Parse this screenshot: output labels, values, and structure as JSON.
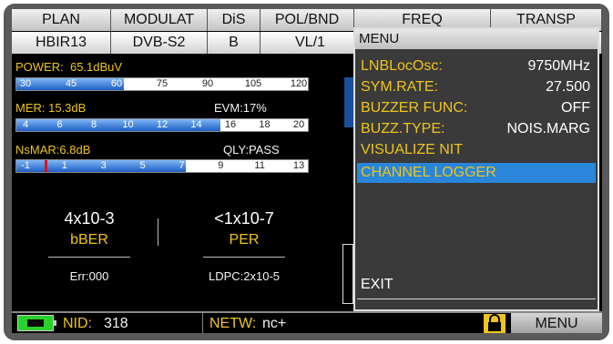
{
  "tabs": [
    "PLAN",
    "MODULAT",
    "DiS",
    "POL/BND",
    "FREQ",
    "TRANSP"
  ],
  "info": [
    "HBIR13",
    "DVB-S2",
    "B",
    "VL/1"
  ],
  "power": {
    "label": "POWER:",
    "value": "65.1dBuV",
    "ticks": [
      "30",
      "45",
      "60",
      "75",
      "90",
      "105",
      "120"
    ],
    "level_fraction": 0.37
  },
  "mer": {
    "label": "MER: 15.3dB",
    "evm": "EVM:17%",
    "ticks": [
      "4",
      "6",
      "8",
      "10",
      "12",
      "14",
      "16",
      "18",
      "20"
    ],
    "level_fraction": 0.7
  },
  "nsmar": {
    "label": "NsMAR:6.8dB",
    "qly": "QLY:PASS",
    "ticks": [
      "-1",
      "1",
      "3",
      "5",
      "7",
      "9",
      "11",
      "13"
    ],
    "level_fraction": 0.58
  },
  "ber": {
    "value": "4x10-3",
    "label": "bBER",
    "err": "Err:000"
  },
  "per": {
    "value": "<1x10-7",
    "label": "PER",
    "ldpc": "LDPC:2x10-5"
  },
  "status": {
    "nid_label": "NID:",
    "nid_value": "318",
    "netw_label": "NETW:",
    "netw_value": "nc+",
    "menu_label": "MENU"
  },
  "menu": {
    "title": "MENU",
    "items": [
      {
        "label": "LNBLocOsc:",
        "value": "9750MHz"
      },
      {
        "label": "SYM.RATE:",
        "value": "27.500"
      },
      {
        "label": "BUZZER FUNC:",
        "value": "OFF"
      },
      {
        "label": "BUZZ.TYPE:",
        "value": "NOIS.MARG"
      },
      {
        "label": "VISUALIZE NIT",
        "value": ""
      },
      {
        "label": "CHANNEL LOGGER",
        "value": ""
      }
    ],
    "exit": "EXIT",
    "selected_index": 5
  },
  "colors": {
    "accent": "#f0c419",
    "selection": "#2a86d8",
    "battery": "#2bd12b"
  }
}
